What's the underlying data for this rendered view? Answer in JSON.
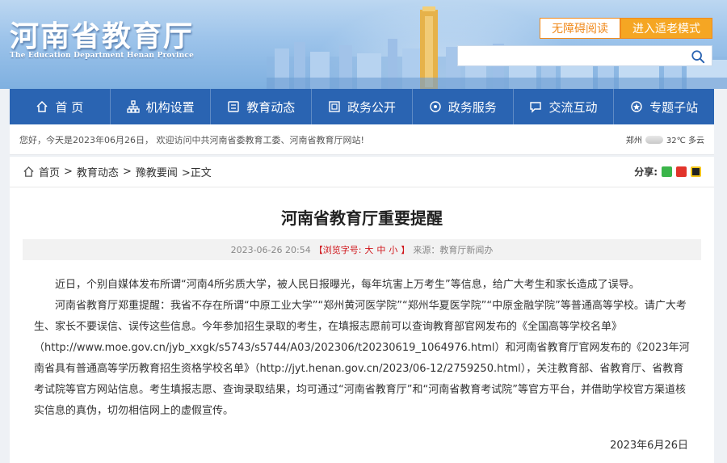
{
  "header": {
    "logo_cn": "河南省教育厅",
    "logo_en": "The Education Department Henan Province",
    "accessible_label": "无障碍阅读",
    "elder_mode_label": "进入适老模式",
    "search_placeholder": ""
  },
  "nav": {
    "items": [
      {
        "label": "首 页",
        "icon": "home-icon"
      },
      {
        "label": "机构设置",
        "icon": "org-icon"
      },
      {
        "label": "教育动态",
        "icon": "news-icon"
      },
      {
        "label": "政务公开",
        "icon": "document-icon"
      },
      {
        "label": "政务服务",
        "icon": "service-icon"
      },
      {
        "label": "交流互动",
        "icon": "chat-icon"
      },
      {
        "label": "专题子站",
        "icon": "topic-icon"
      }
    ]
  },
  "welcome": {
    "text": "您好，今天是2023年06月26日， 欢迎访问中共河南省委教育工委、河南省教育厅网站!",
    "city": "郑州",
    "weather": "32℃ 多云"
  },
  "breadcrumb": {
    "home": "首页",
    "sep": ">",
    "level1": "教育动态",
    "level2": "豫教要闻",
    "current": ">正文",
    "share_label": "分享:"
  },
  "article": {
    "title": "河南省教育厅重要提醒",
    "datetime": "2023-06-26 20:54",
    "font_size_prefix": "【浏览字号:",
    "font_large": "大",
    "font_medium": "中",
    "font_small": "小",
    "font_size_suffix": "】",
    "source": "来源：教育厅新闻办",
    "paragraphs": [
      "近日，个别自媒体发布所谓“河南4所劣质大学，被人民日报曝光，每年坑害上万考生”等信息，给广大考生和家长造成了误导。",
      "河南省教育厅郑重提醒：我省不存在所谓“中原工业大学”“郑州黄河医学院”“郑州华夏医学院”“中原金融学院”等普通高等学校。请广大考生、家长不要误信、误传这些信息。今年参加招生录取的考生，在填报志愿前可以查询教育部官网发布的《全国高等学校名单》（http://www.moe.gov.cn/jyb_xxgk/s5743/s5744/A03/202306/t20230619_1064976.html）和河南省教育厅官网发布的《2023年河南省具有普通高等学历教育招生资格学校名单》（http://jyt.henan.gov.cn/2023/06-12/2759250.html），关注教育部、省教育厅、省教育考试院等官方网站信息。考生填报志愿、查询录取结果，均可通过“河南省教育厅”和“河南省教育考试院”等官方平台，并借助学校官方渠道核实信息的真伪，切勿相信网上的虚假宣传。"
    ],
    "date": "2023年6月26日"
  },
  "colors": {
    "nav_bg": "#2a64b2",
    "accent_orange": "#f08a1c",
    "red": "#d0161b"
  }
}
